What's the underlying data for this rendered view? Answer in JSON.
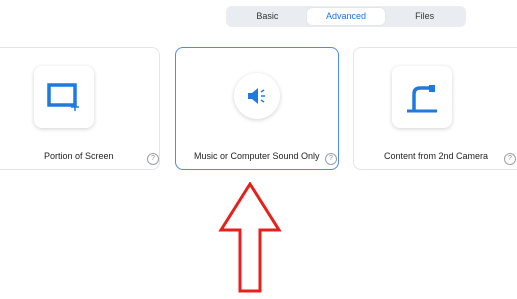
{
  "tabs": [
    {
      "label": "Basic",
      "active": false
    },
    {
      "label": "Advanced",
      "active": true
    },
    {
      "label": "Files",
      "active": false
    }
  ],
  "options": [
    {
      "label": "Portion of Screen",
      "icon": "portion-screen-icon",
      "help": "?"
    },
    {
      "label": "Music or Computer Sound Only",
      "icon": "speaker-icon",
      "help": "?",
      "selected": true
    },
    {
      "label": "Content from 2nd Camera",
      "icon": "camera-icon",
      "help": "?"
    }
  ],
  "colors": {
    "accent": "#1a73e8",
    "selected_border": "#4a8cf0",
    "icon_blue": "#1f7ae0",
    "annotation": "#e8201b"
  }
}
